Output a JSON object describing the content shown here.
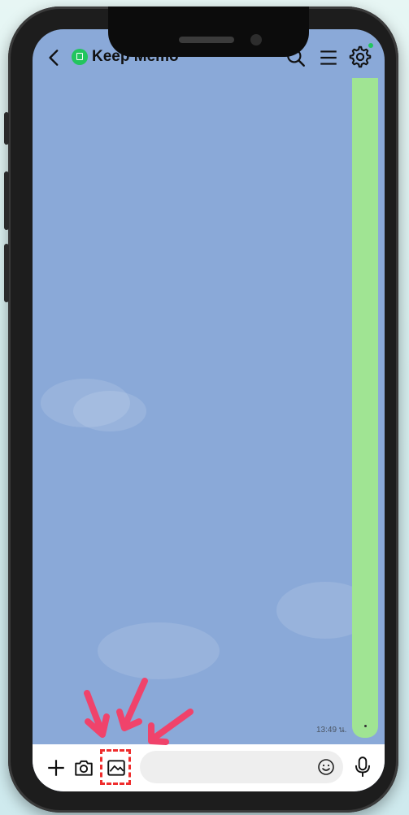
{
  "header": {
    "title": "Keep Memo"
  },
  "message": {
    "timestamp": "13:49 น."
  },
  "input": {
    "placeholder": "",
    "value": ""
  },
  "colors": {
    "chat_background": "#8aa9d8",
    "bubble": "#a0e493",
    "accent": "#22c55e",
    "highlight": "#ef2d2d",
    "arrow": "#f0436b"
  },
  "icons": [
    "back-icon",
    "keep-icon",
    "search-icon",
    "menu-icon",
    "gear-icon",
    "plus-icon",
    "camera-icon",
    "image-icon",
    "emoji-icon",
    "mic-icon"
  ]
}
